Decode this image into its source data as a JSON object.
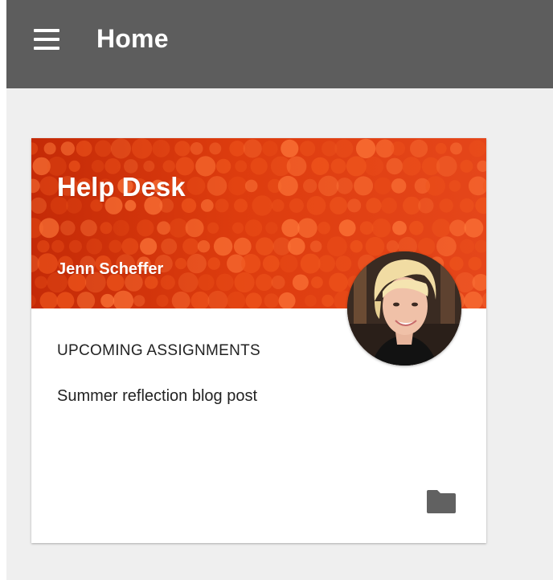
{
  "header": {
    "title": "Home",
    "menu_icon": "hamburger-menu-icon",
    "background_color": "#5d5d5d"
  },
  "class_card": {
    "title": "Help Desk",
    "teacher": "Jenn Scheffer",
    "banner_color": "#dd3c0e",
    "upcoming": {
      "heading": "UPCOMING ASSIGNMENTS",
      "items": [
        "Summer reflection blog post"
      ]
    },
    "folder_icon": "folder-icon"
  }
}
